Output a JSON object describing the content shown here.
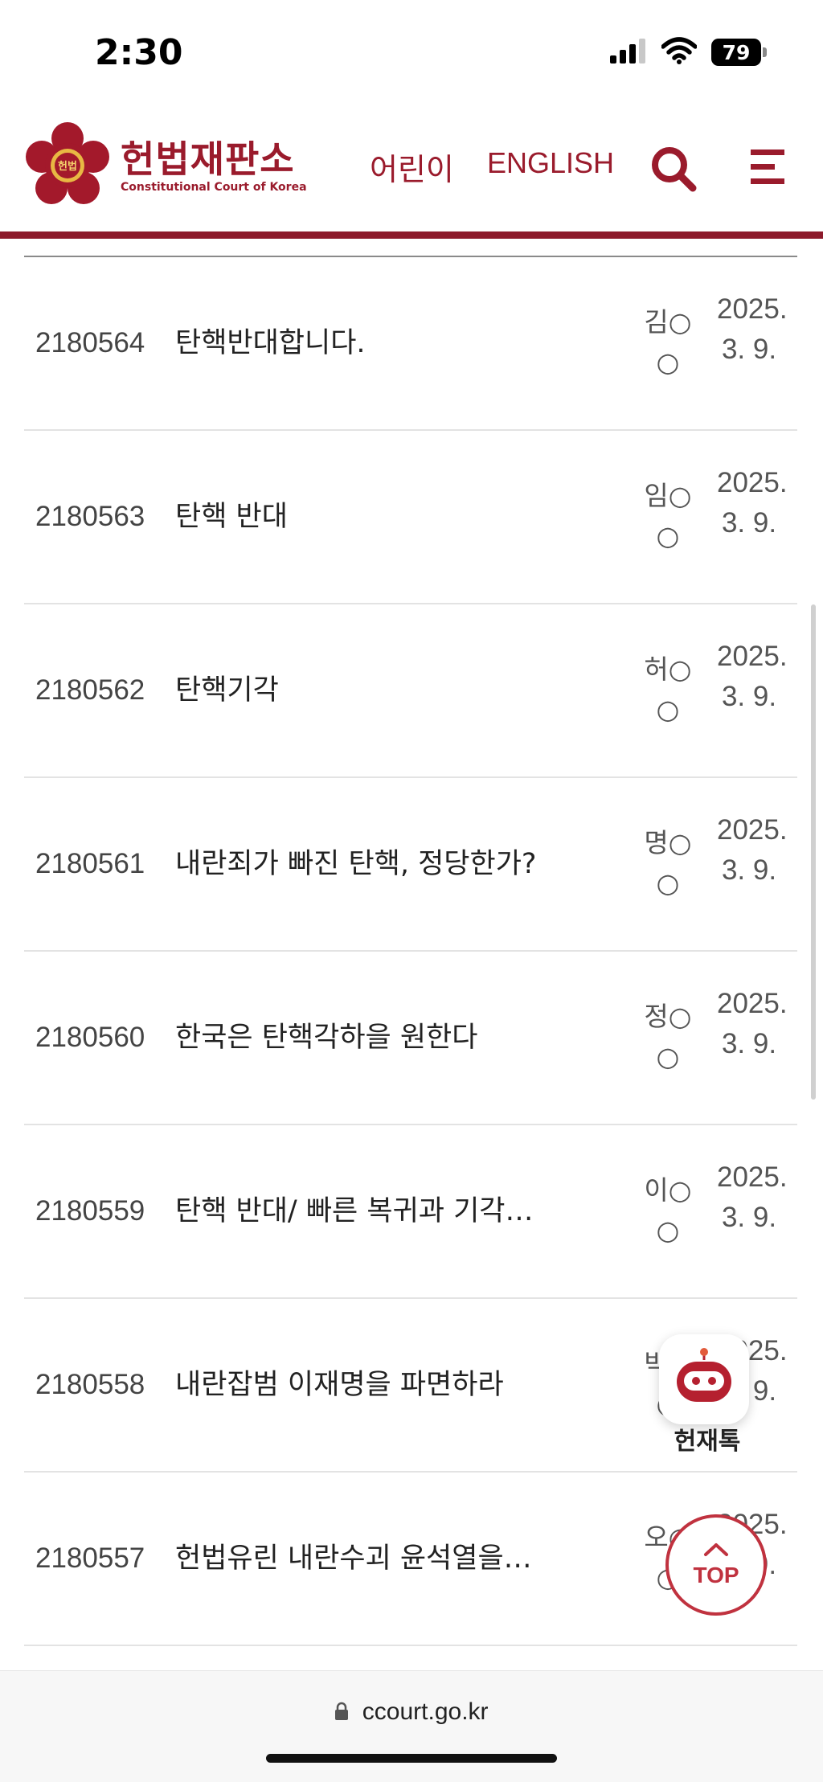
{
  "status_bar": {
    "time": "2:30",
    "battery": "79"
  },
  "header": {
    "logo_title": "헌법재판소",
    "logo_subtitle": "Constitutional Court of Korea",
    "logo_badge": "헌법",
    "nav_kids": "어린이",
    "nav_english": "ENGLISH",
    "brand_color": "#9a1b2c"
  },
  "posts": [
    {
      "number": "2180564",
      "title": "탄핵반대합니다.",
      "author": "김○○",
      "date": "2025. 3. 9."
    },
    {
      "number": "2180563",
      "title": "탄핵 반대",
      "author": "임○○",
      "date": "2025. 3. 9."
    },
    {
      "number": "2180562",
      "title": "탄핵기각",
      "author": "허○○",
      "date": "2025. 3. 9."
    },
    {
      "number": "2180561",
      "title": "내란죄가 빠진 탄핵, 정당한가?",
      "author": "명○○",
      "date": "2025. 3. 9."
    },
    {
      "number": "2180560",
      "title": "한국은 탄핵각하을 원한다",
      "author": "정○○",
      "date": "2025. 3. 9."
    },
    {
      "number": "2180559",
      "title": "탄핵 반대/ 빠른 복귀과 기각…",
      "author": "이○○",
      "date": "2025. 3. 9."
    },
    {
      "number": "2180558",
      "title": "내란잡범 이재명을 파면하라",
      "author": "박○○",
      "date": "2025. 3. 9."
    },
    {
      "number": "2180557",
      "title": "헌법유린 내란수괴 윤석열을…",
      "author": "오○○",
      "date": "2025. 3. 9."
    }
  ],
  "chatbot": {
    "label": "헌재톡"
  },
  "top_button": {
    "label": "TOP"
  },
  "browser": {
    "url": "ccourt.go.kr"
  }
}
